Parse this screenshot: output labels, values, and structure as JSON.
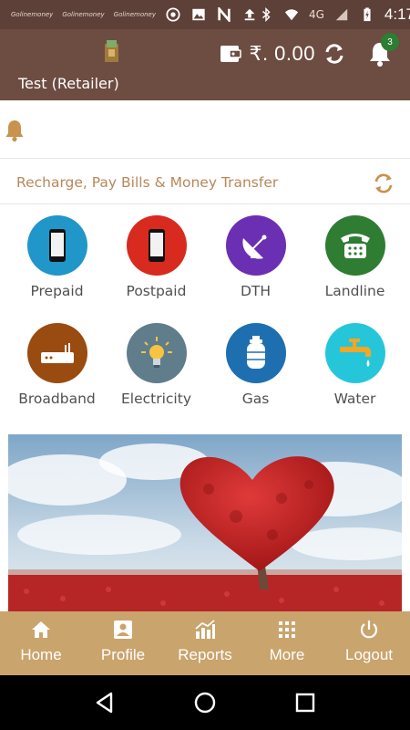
{
  "status_bar": {
    "notif_labels": [
      "Golinemoney",
      "Golinemoney",
      "Golinemoney"
    ],
    "network": "4G",
    "time": "4:17"
  },
  "header": {
    "user_name": "Test (Retailer)",
    "balance": "₹. 0.00",
    "notification_count": "3"
  },
  "section": {
    "title": "Recharge, Pay Bills & Money Transfer"
  },
  "services": [
    {
      "label": "Prepaid",
      "color": "#2196c9",
      "icon": "mobile-icon"
    },
    {
      "label": "Postpaid",
      "color": "#d82a1e",
      "icon": "mobile-icon"
    },
    {
      "label": "DTH",
      "color": "#6a2fb3",
      "icon": "satellite-dish-icon"
    },
    {
      "label": "Landline",
      "color": "#2e7d32",
      "icon": "telephone-icon"
    },
    {
      "label": "Broadband",
      "color": "#9a4b10",
      "icon": "router-icon"
    },
    {
      "label": "Electricity",
      "color": "#607d8b",
      "icon": "light-bulb-icon"
    },
    {
      "label": "Gas",
      "color": "#1e6fb0",
      "icon": "gas-cylinder-icon"
    },
    {
      "label": "Water",
      "color": "#26c6da",
      "icon": "water-tap-icon"
    }
  ],
  "bottom_nav": [
    {
      "label": "Home",
      "icon": "home-icon"
    },
    {
      "label": "Profile",
      "icon": "profile-icon"
    },
    {
      "label": "Reports",
      "icon": "reports-icon"
    },
    {
      "label": "More",
      "icon": "grid-icon"
    },
    {
      "label": "Logout",
      "icon": "power-icon"
    }
  ],
  "colors": {
    "header": "#6d4c41",
    "status_bar": "#5d4037",
    "accent": "#b8875a",
    "bottom_nav": "#c9a46d"
  }
}
